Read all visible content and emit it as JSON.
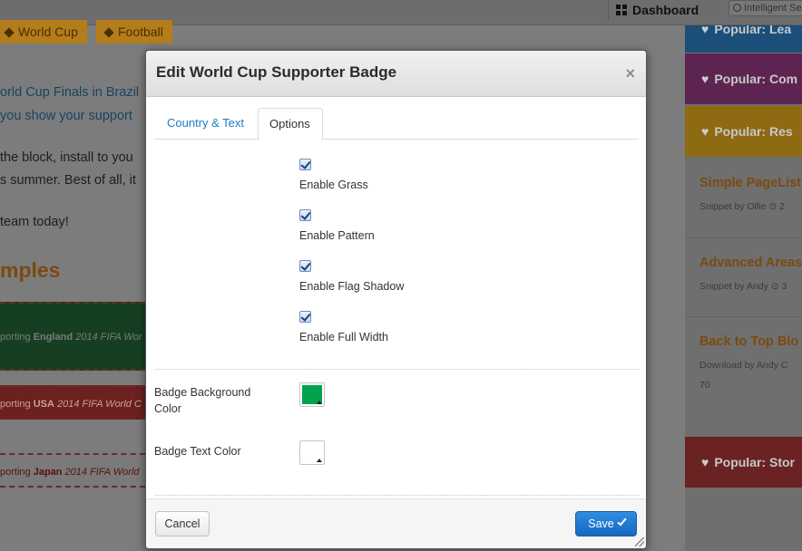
{
  "background": {
    "topbar": {
      "dashboard_label": "Dashboard",
      "search_placeholder": "Intelligent Se"
    },
    "tags": [
      "World Cup",
      "Football"
    ],
    "paragraph_lines": [
      "orld Cup Finals in Brazil",
      "you show your support",
      "the block, install to you",
      "s summer. Best of all, it",
      "team today!"
    ],
    "section_heading": "mples",
    "example_bands": [
      {
        "prefix": "porting ",
        "country": "England",
        "suffix": " 2014 FIFA Wor"
      },
      {
        "prefix": "porting ",
        "country": "USA",
        "suffix": " 2014 FIFA World C"
      },
      {
        "prefix": "porting ",
        "country": "Japan",
        "suffix": " 2014 FIFA World"
      }
    ],
    "sidebar": {
      "popular": [
        "Popular: Lea",
        "Popular: Com",
        "Popular: Res",
        "Popular: Stor"
      ],
      "items": [
        {
          "title": "Simple PageList",
          "meta": "Snippet by Ollie ⊙ 2"
        },
        {
          "title": "Advanced Areas",
          "meta": "Snippet by Andy ⊙ 3"
        },
        {
          "title": "Back to Top Blo",
          "meta": "Download by Andy C",
          "extra": "70"
        }
      ]
    }
  },
  "modal": {
    "title": "Edit World Cup Supporter Badge",
    "close_symbol": "×",
    "tabs": [
      {
        "label": "Country & Text",
        "active": false
      },
      {
        "label": "Options",
        "active": true
      }
    ],
    "options": [
      {
        "label": "Enable Grass",
        "checked": true
      },
      {
        "label": "Enable Pattern",
        "checked": true
      },
      {
        "label": "Enable Flag Shadow",
        "checked": true
      },
      {
        "label": "Enable Full Width",
        "checked": true
      }
    ],
    "color_fields": [
      {
        "label": "Badge Background Color",
        "color": "#00a34b"
      },
      {
        "label": "Badge Text Color",
        "color": "#ffffff"
      }
    ],
    "footer": {
      "cancel_label": "Cancel",
      "save_label": "Save"
    }
  }
}
